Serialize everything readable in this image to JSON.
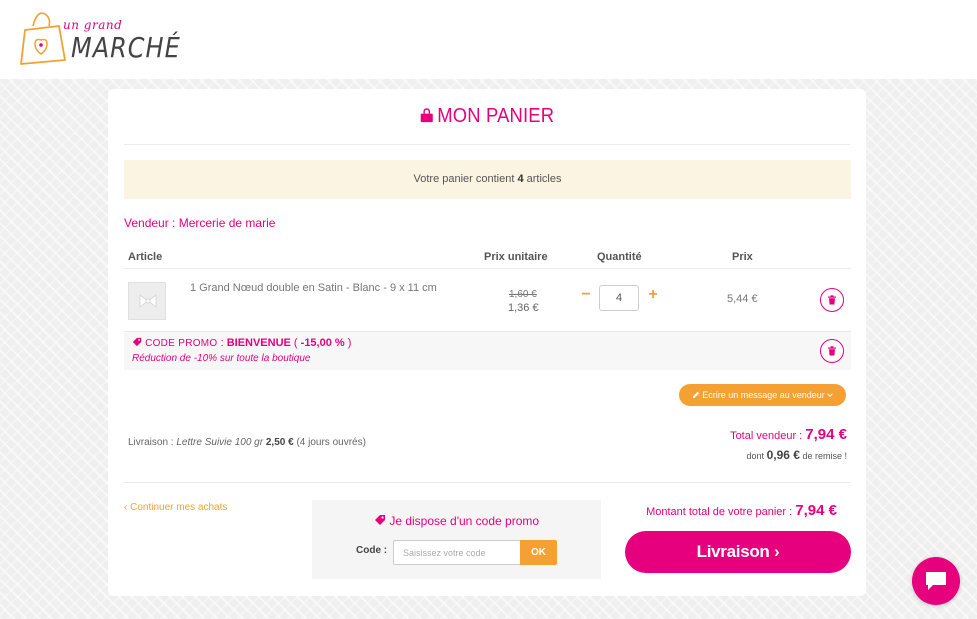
{
  "brand": {
    "logo_small": "un grand",
    "logo_big": "MARCHÉ",
    "accent": "#e6007e",
    "secondary": "#f5a033"
  },
  "cart": {
    "title": "MON PANIER",
    "notice_prefix": "Votre panier contient",
    "notice_count": "4",
    "notice_suffix": "articles",
    "vendor_label": "Vendeur : Mercerie de marie",
    "headers": {
      "article": "Article",
      "unit_price": "Prix unitaire",
      "quantity": "Quantité",
      "price": "Prix"
    },
    "item": {
      "name": "1 Grand Nœud double en Satin - Blanc - 9 x 11 cm",
      "old_price": "1,60 €",
      "unit_price": "1,36 €",
      "quantity": "4",
      "line_price": "5,44 €",
      "minus": "−",
      "plus": "+"
    },
    "promo": {
      "code_label": "CODE PROMO",
      "sep": " : ",
      "code": "BIENVENUE",
      "discount": "-15,00 %",
      "description": "Réduction de -10% sur toute la boutique"
    },
    "message_button": "Ecrire un message au vendeur",
    "shipping": {
      "prefix": "Livraison :",
      "method": "Lettre Suivie 100 gr",
      "price": "2,50 €",
      "delay": "(4 jours ouvrés)"
    },
    "vendor_total_label": "Total vendeur :",
    "vendor_total": "7,94 €",
    "discount_prefix": "dont",
    "discount_amount": "0,96 €",
    "discount_suffix": "de remise !",
    "continue_label": "Continuer mes achats",
    "promo_box": {
      "title": "Je dispose d'un code promo",
      "code_label": "Code :",
      "placeholder": "Saisissez votre code",
      "ok": "OK"
    },
    "grand_total_label": "Montant total de votre panier :",
    "grand_total": "7,94 €",
    "checkout_label": "Livraison"
  },
  "icons": {
    "bag": "shopping-bag-icon",
    "tag": "tag-icon",
    "trash": "trash-icon",
    "pencil": "pencil-icon",
    "chevron": "chevron-down-icon",
    "chat": "chat-icon"
  }
}
